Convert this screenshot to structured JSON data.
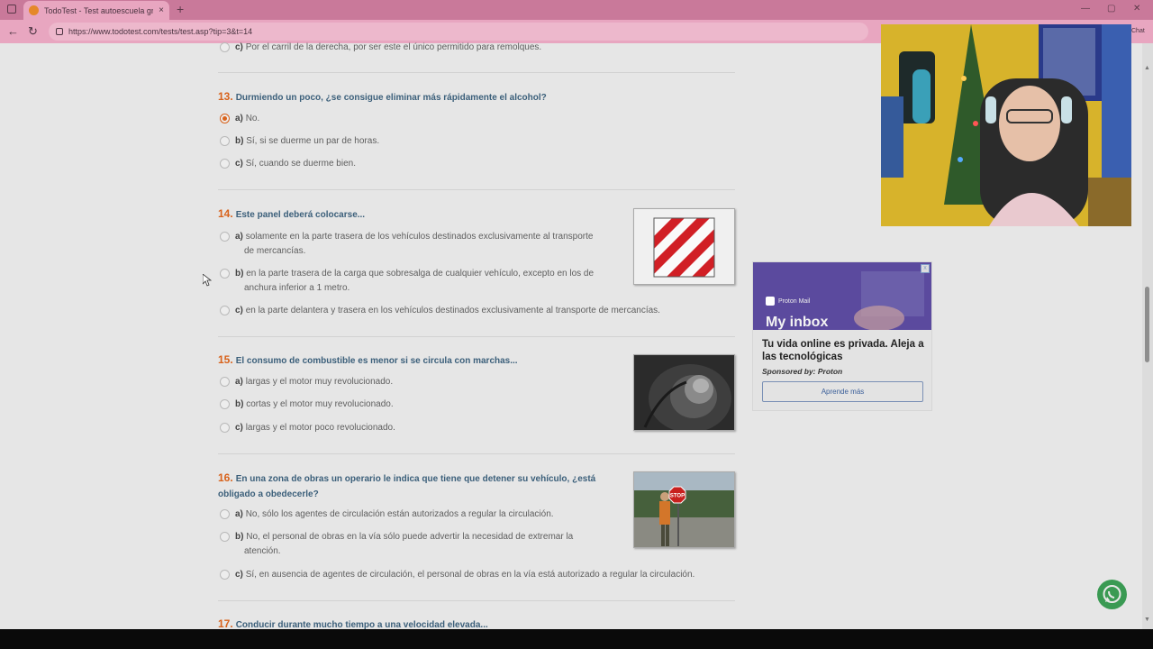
{
  "browser": {
    "tab_title": "TodoTest - Test autoescuela grati",
    "tab_close": "×",
    "new_tab": "+",
    "url": "https://www.todotest.com/tests/test.asp?tip=3&t=14",
    "chat_label": "Chat",
    "win_min": "—",
    "win_max": "▢",
    "win_close": "✕"
  },
  "prev_option": {
    "letter": "c)",
    "text": "Por el carril de la derecha, por ser este el único permitido para remolques."
  },
  "questions": [
    {
      "number": "13.",
      "text": "Durmiendo un poco, ¿se consigue eliminar más rápidamente el alcohol?",
      "options": [
        {
          "letter": "a)",
          "text": "No.",
          "selected": true
        },
        {
          "letter": "b)",
          "text": "Sí, si se duerme un par de horas.",
          "selected": false
        },
        {
          "letter": "c)",
          "text": "Sí, cuando se duerme bien.",
          "selected": false
        }
      ]
    },
    {
      "number": "14.",
      "text": "Este panel deberá colocarse...",
      "options": [
        {
          "letter": "a)",
          "text": "solamente en la parte trasera de los vehículos destinados exclusivamente al transporte",
          "text2": "de mercancías."
        },
        {
          "letter": "b)",
          "text": "en la parte trasera de la carga que sobresalga de cualquier vehículo, excepto en los de",
          "text2": "anchura inferior a 1 metro."
        },
        {
          "letter": "c)",
          "text": "en la parte delantera y trasera en los vehículos destinados exclusivamente al transporte de mercancías."
        }
      ]
    },
    {
      "number": "15.",
      "text": "El consumo de combustible es menor si se circula con marchas...",
      "options": [
        {
          "letter": "a)",
          "text": "largas y el motor muy revolucionado."
        },
        {
          "letter": "b)",
          "text": "cortas y el motor muy revolucionado."
        },
        {
          "letter": "c)",
          "text": "largas y el motor poco revolucionado."
        }
      ]
    },
    {
      "number": "16.",
      "text": "En una zona de obras un operario le indica que tiene que detener su vehículo, ¿está",
      "text2": "obligado a obedecerle?",
      "options": [
        {
          "letter": "a)",
          "text": "No, sólo los agentes de circulación están autorizados a regular la circulación."
        },
        {
          "letter": "b)",
          "text": "No, el personal de obras en la vía sólo puede advertir la necesidad de extremar la",
          "text2": "atención."
        },
        {
          "letter": "c)",
          "text": "Sí, en ausencia de agentes de circulación, el personal de obras en la vía está autorizado a regular la circulación."
        }
      ]
    },
    {
      "number": "17.",
      "text": "Conducir durante mucho tiempo a una velocidad elevada..."
    }
  ],
  "images": {
    "q14": "red-white-striped-panel",
    "q15": "gear-stick",
    "q16": "stop-sign-worker",
    "stop_text": "STOP"
  },
  "ad": {
    "brand": "Proton Mail",
    "banner_text": "My inbox",
    "headline": "Tu vida online es privada. Aleja a las tecnológicas",
    "sponsor": "Sponsored by: Proton",
    "cta": "Aprende más",
    "close": "x"
  },
  "colors": {
    "accent": "#d8621b",
    "question_text": "#3b5f7a",
    "tab_pink": "#c9799a"
  }
}
